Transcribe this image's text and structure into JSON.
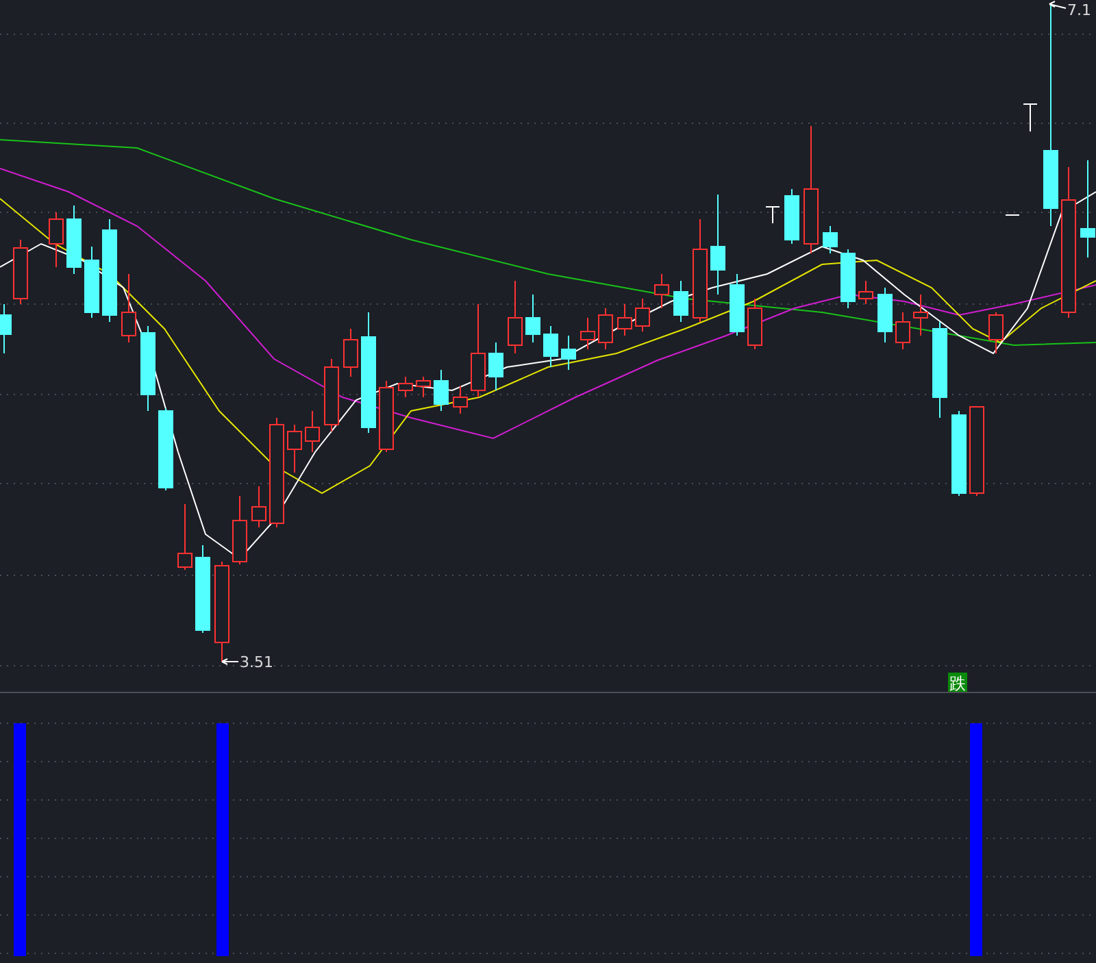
{
  "price_chart": {
    "high_label": "7.1",
    "low_label": "3.51"
  },
  "signal_label": "跌"
}
